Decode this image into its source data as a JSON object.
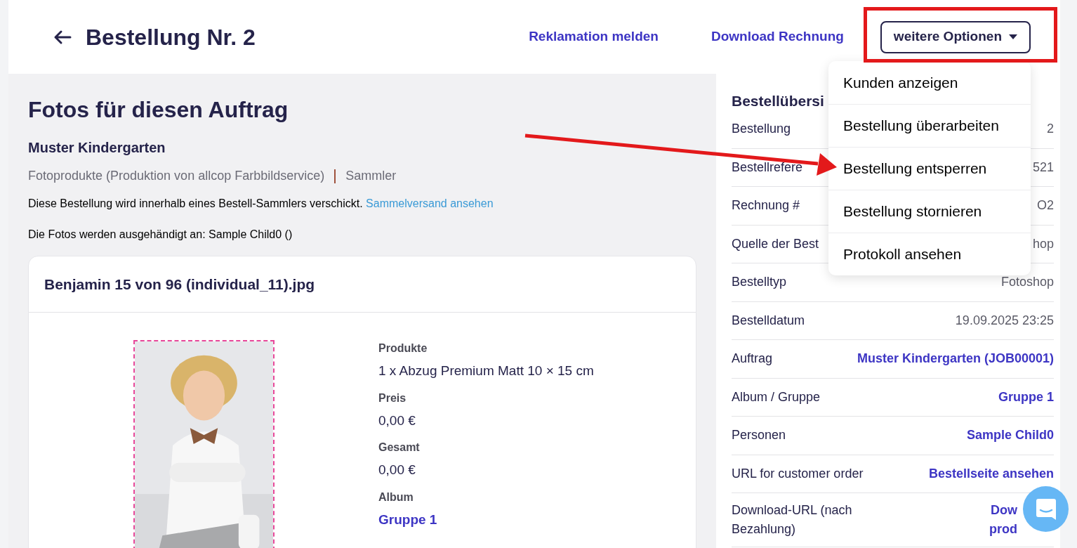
{
  "header": {
    "title": "Bestellung Nr. 2",
    "links": [
      "Reklamation melden",
      "Download Rechnung"
    ],
    "options_button": {
      "label": "weitere Optionen",
      "expanded": true
    }
  },
  "menu": {
    "items": [
      {
        "label": "Kunden anzeigen"
      },
      {
        "label": "Bestellung überarbeiten"
      },
      {
        "label": "Bestellung entsperren"
      },
      {
        "label": "Bestellung stornieren"
      },
      {
        "label": "Protokoll ansehen"
      }
    ]
  },
  "main": {
    "heading": "Fotos für diesen Auftrag",
    "customer": "Muster Kindergarten",
    "product_line": "Fotoprodukte (Produktion von allcop Farbbildservice)",
    "collector": "Sammler",
    "notice": "Diese Bestellung wird innerhalb eines Bestell-Sammlers verschickt.",
    "notice_link": "Sammelversand ansehen",
    "handover": "Die Fotos werden ausgehändigt an: Sample Child0 ()",
    "card": {
      "title": "Benjamin 15 von 96 (individual_11).jpg",
      "fields": [
        {
          "label": "Produkte",
          "value": "1 x Abzug Premium Matt 10 × 15 cm",
          "kind": "text"
        },
        {
          "label": "Preis",
          "value": "0,00 €",
          "kind": "text"
        },
        {
          "label": "Gesamt",
          "value": "0,00 €",
          "kind": "text"
        },
        {
          "label": "Album",
          "value": "Gruppe 1",
          "kind": "link"
        }
      ]
    }
  },
  "sidebar": {
    "title": "Bestellübersi",
    "rows": [
      {
        "label": "Bestellung",
        "value": "2",
        "kind": "text"
      },
      {
        "label": "Bestellrefere",
        "value": "521",
        "kind": "text"
      },
      {
        "label": "Rechnung #",
        "value": "O2",
        "kind": "text"
      },
      {
        "label": "Quelle der Best",
        "value": "hop",
        "kind": "text"
      },
      {
        "label": "Bestelltyp",
        "value": "Fotoshop",
        "kind": "text"
      },
      {
        "label": "Bestelldatum",
        "value": "19.09.2025 23:25",
        "kind": "text"
      },
      {
        "label": "Auftrag",
        "value": "Muster Kindergarten (JOB00001)",
        "kind": "link"
      },
      {
        "label": "Album / Gruppe",
        "value": "Gruppe 1",
        "kind": "link"
      },
      {
        "label": "Personen",
        "value": "Sample Child0",
        "kind": "link"
      },
      {
        "label": "URL for customer order",
        "value": "Bestellseite ansehen",
        "kind": "link"
      },
      {
        "label": "Download-URL (nach Bezahlung)",
        "value": "Dow",
        "value_2": "prod",
        "kind": "link"
      }
    ]
  }
}
